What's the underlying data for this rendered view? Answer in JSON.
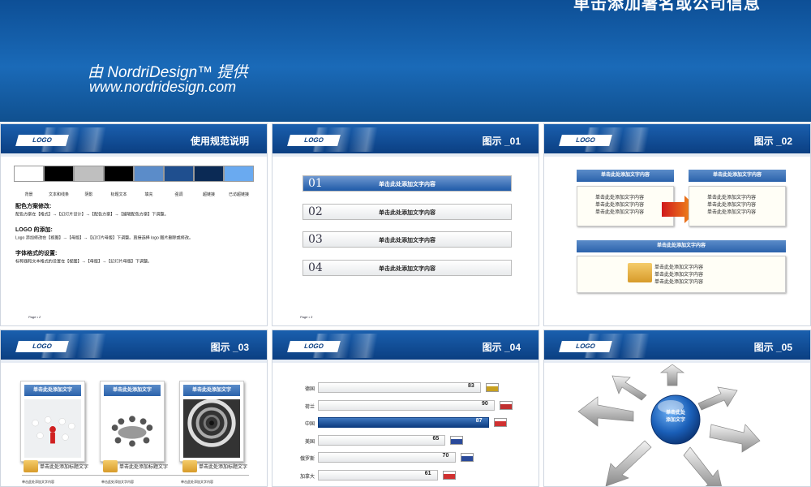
{
  "banner": {
    "title": "单击添加署名或公司信息",
    "provider": "由 NordriDesign™ 提供",
    "url": "www.nordridesign.com"
  },
  "slides": [
    {
      "logo": "LOGO",
      "title": "使用规范说明",
      "page": "Page • 2",
      "swatches": [
        {
          "label": "背景",
          "color": "#ffffff"
        },
        {
          "label": "文本和线条",
          "color": "#000000"
        },
        {
          "label": "阴影",
          "color": "#bfbfbf"
        },
        {
          "label": "标题文本",
          "color": "#000000"
        },
        {
          "label": "填充",
          "color": "#5b8cc9"
        },
        {
          "label": "强调",
          "color": "#1f4f8f"
        },
        {
          "label": "超链接",
          "color": "#0b2a55"
        },
        {
          "label": "已访超链接",
          "color": "#6aaaf0"
        }
      ],
      "sections": [
        {
          "head": "配色方案修改:",
          "body": "配色方案在【格式】→【幻灯片设计】→【配色方案】→【编辑配色方案】下调整。"
        },
        {
          "head": "LOGO 的添加:",
          "body": "Logo 添加修改在【视图】→【母版】→【幻灯片母版】下调整。直接选择 logo 图片删除或修改。"
        },
        {
          "head": "字体格式的设置:",
          "body": "标称题和文本格式的设置在【视图】→【母版】→【幻灯片母版】下调整。"
        }
      ]
    },
    {
      "logo": "LOGO",
      "title": "图示 _01",
      "page": "Page • 3",
      "items": [
        {
          "num": "01",
          "label": "单击此处添加文字内容"
        },
        {
          "num": "02",
          "label": "单击此处添加文字内容"
        },
        {
          "num": "03",
          "label": "单击此处添加文字内容"
        },
        {
          "num": "04",
          "label": "单击此处添加文字内容"
        }
      ]
    },
    {
      "logo": "LOGO",
      "title": "图示 _02",
      "page": "Page • 4",
      "box_a": "单击此处添加文字内容",
      "box_b": "单击此处添加文字内容",
      "box_c": "单击此处添加文字内容",
      "line": "单击此处添加文字内容"
    },
    {
      "logo": "LOGO",
      "title": "图示 _03",
      "caption": "单击此处添加文字",
      "subtitle": "单击此处添加标题文字",
      "small": "单击此处添加文字内容"
    },
    {
      "logo": "LOGO",
      "title": "图示 _04"
    },
    {
      "logo": "LOGO",
      "title": "图示 _05",
      "center_line1": "单击此处",
      "center_line2": "添加文字"
    }
  ],
  "chart_data": {
    "type": "bar",
    "categories": [
      "德国",
      "荷兰",
      "中国",
      "美国",
      "俄罗斯",
      "加拿大"
    ],
    "values": [
      83,
      90,
      87,
      65,
      70,
      61
    ],
    "highlight": "中国",
    "flag_colors": [
      "#c8a020",
      "#c03030",
      "#d03030",
      "#2a4a9a",
      "#2a4a9a",
      "#d03030"
    ]
  }
}
